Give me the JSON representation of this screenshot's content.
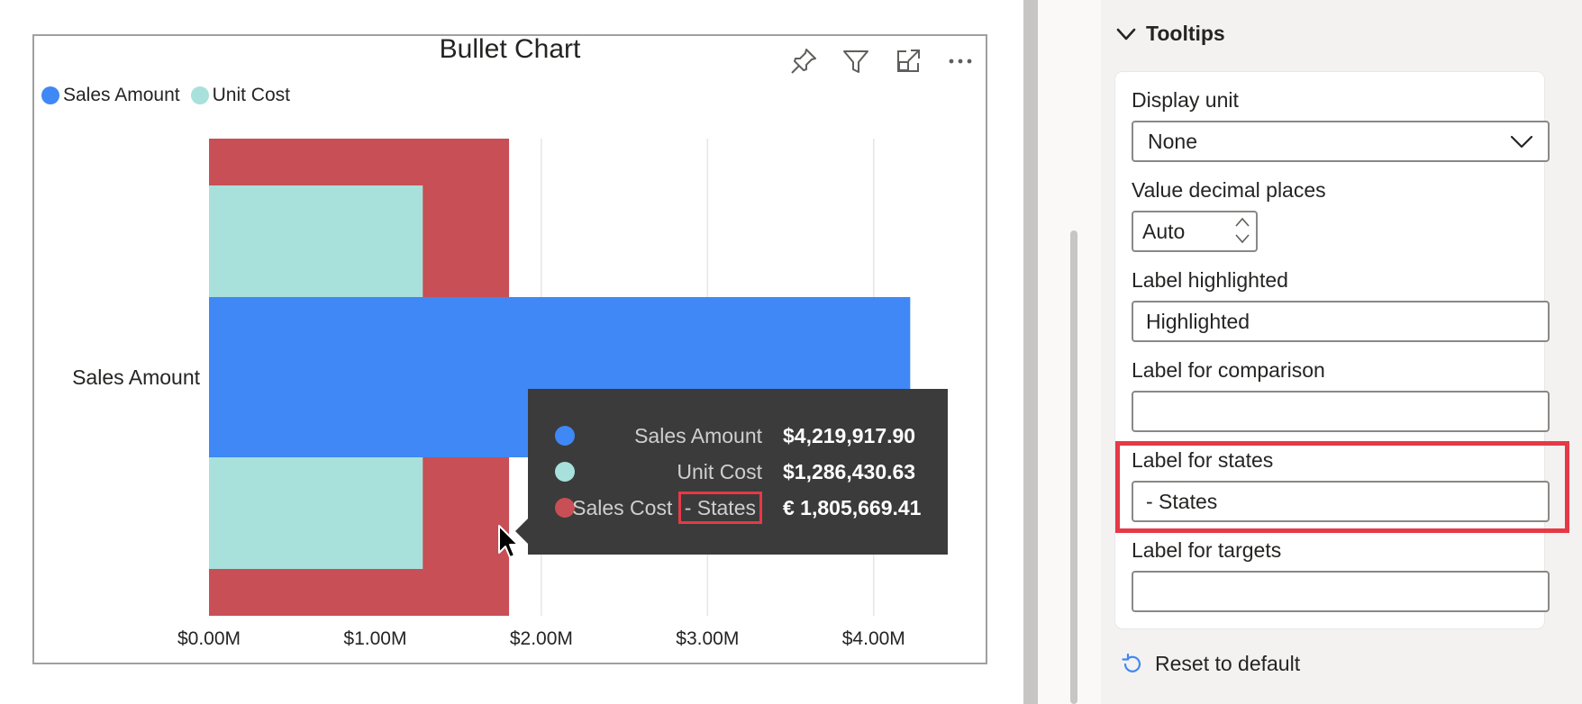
{
  "chart": {
    "title": "Bullet Chart",
    "header_icons": [
      "pin-icon",
      "filter-icon",
      "focus-mode-icon",
      "more-options-icon"
    ],
    "legend": [
      {
        "label": "Sales Amount",
        "color": "#3f88f5"
      },
      {
        "label": "Unit Cost",
        "color": "#a8e1db"
      }
    ]
  },
  "chart_data": {
    "type": "bar",
    "orientation": "horizontal",
    "title": "Bullet Chart",
    "categories": [
      "Sales Amount"
    ],
    "xlim": [
      0,
      4500000
    ],
    "xticks": [
      "$0.00M",
      "$1.00M",
      "$2.00M",
      "$3.00M",
      "$4.00M"
    ],
    "xtick_values": [
      0,
      1000000,
      2000000,
      3000000,
      4000000
    ],
    "grid": true,
    "legend_position": "top-left",
    "series": [
      {
        "name": "Sales Cost - States",
        "values": [
          1805669.41
        ],
        "color": "#c84f55",
        "role": "state band"
      },
      {
        "name": "Unit Cost",
        "values": [
          1286430.63
        ],
        "color": "#a8e1db",
        "role": "comparison band"
      },
      {
        "name": "Sales Amount",
        "values": [
          4219917.9
        ],
        "color": "#3f88f5",
        "role": "measure bar"
      }
    ]
  },
  "tooltip": {
    "rows": [
      {
        "name": "Sales Amount",
        "value": "$4,219,917.90",
        "color": "#3f88f5"
      },
      {
        "name": "Unit Cost",
        "value": "$1,286,430.63",
        "color": "#a8e1db"
      },
      {
        "name_prefix": "Sales Cost",
        "name_highlight": "- States",
        "value": "€ 1,805,669.41",
        "color": "#c84f55"
      }
    ]
  },
  "format_pane": {
    "section_title": "Tooltips",
    "display_unit": {
      "label": "Display unit",
      "value": "None"
    },
    "decimal_places": {
      "label": "Value decimal places",
      "value": "Auto"
    },
    "label_highlighted": {
      "label": "Label highlighted",
      "value": "Highlighted"
    },
    "label_comparison": {
      "label": "Label for comparison",
      "value": ""
    },
    "label_states": {
      "label": "Label for states",
      "value": "- States"
    },
    "label_targets": {
      "label": "Label for targets",
      "value": ""
    },
    "reset_label": "Reset to default",
    "highlight_color": "#e63946"
  }
}
